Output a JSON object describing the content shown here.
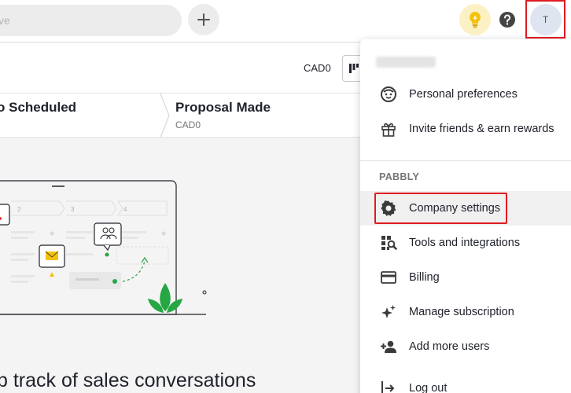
{
  "topbar": {
    "search_placeholder": "ve",
    "avatar_initial": "T"
  },
  "toolbar": {
    "currency": "CAD0"
  },
  "pipeline": {
    "stages": [
      {
        "title": "o Scheduled",
        "subtitle": ""
      },
      {
        "title": "Proposal Made",
        "subtitle": "CAD0"
      }
    ]
  },
  "illustration": {
    "step_numbers": [
      "2",
      "3",
      "4"
    ]
  },
  "empty_state": {
    "headline": "p track of sales conversations"
  },
  "menu": {
    "items_top": [
      {
        "label": "Personal preferences",
        "icon": "smiley-icon"
      },
      {
        "label": "Invite friends & earn rewards",
        "icon": "gift-icon"
      }
    ],
    "section_label": "PABBLY",
    "items_company": [
      {
        "label": "Company settings",
        "icon": "gear-icon"
      },
      {
        "label": "Tools and integrations",
        "icon": "tools-icon"
      },
      {
        "label": "Billing",
        "icon": "card-icon"
      },
      {
        "label": "Manage subscription",
        "icon": "sparkle-icon"
      },
      {
        "label": "Add more users",
        "icon": "add-user-icon"
      },
      {
        "label": "Log out",
        "icon": "logout-icon"
      }
    ]
  },
  "colors": {
    "accent_green": "#26a744",
    "highlight_red": "#e01b22",
    "bulb_yellow": "#f4c20d"
  }
}
